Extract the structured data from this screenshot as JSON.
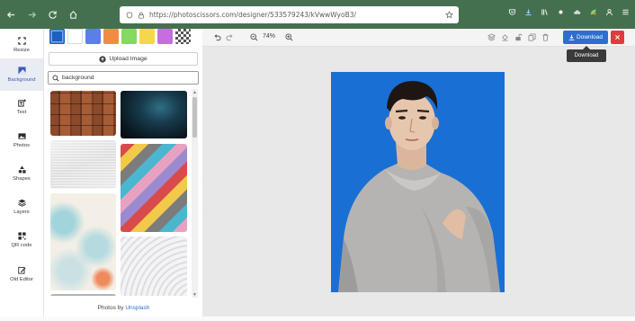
{
  "browser": {
    "url": "https://photoscissors.com/designer/533579243/kVwwWyoB3/",
    "accent": "#45704f"
  },
  "rail": {
    "items": [
      {
        "label": "Resize",
        "icon": "resize-icon"
      },
      {
        "label": "Background",
        "icon": "background-icon",
        "active": true
      },
      {
        "label": "Text",
        "icon": "text-icon"
      },
      {
        "label": "Photos",
        "icon": "photos-icon"
      },
      {
        "label": "Shapes",
        "icon": "shapes-icon"
      },
      {
        "label": "Layers",
        "icon": "layers-icon"
      },
      {
        "label": "QR code",
        "icon": "qr-code-icon"
      },
      {
        "label": "Old Editor",
        "icon": "old-editor-icon"
      }
    ]
  },
  "panel": {
    "swatches": [
      "#1e5fbf",
      "#ffffff",
      "#5b7fe8",
      "#f28c45",
      "#85d860",
      "#f4d84a",
      "#c56ee0",
      "checker"
    ],
    "upload_label": "Upload Image",
    "search_value": "background",
    "credit_prefix": "Photos by",
    "credit_link": "Unsplash"
  },
  "toolbar": {
    "zoom": "74%",
    "download_label": "Download",
    "tooltip": "Download",
    "download_color": "#2d6fcf",
    "close_color": "#e03c3c"
  },
  "design": {
    "background_color": "#1a6fd4"
  }
}
